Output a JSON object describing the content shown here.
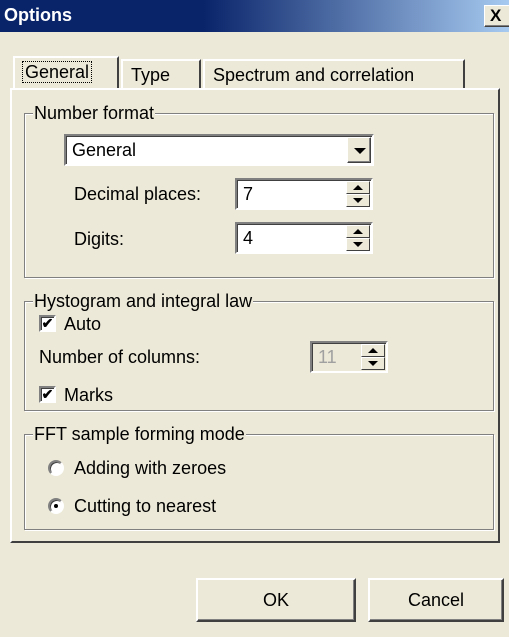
{
  "window": {
    "title": "Options",
    "close_glyph": "X"
  },
  "tabs": [
    {
      "label": "General",
      "active": true
    },
    {
      "label": "Type",
      "active": false
    },
    {
      "label": "Spectrum and correlation",
      "active": false
    }
  ],
  "number_format": {
    "legend": "Number format",
    "format_value": "General",
    "decimal_places_label": "Decimal places:",
    "decimal_places_value": "7",
    "digits_label": "Digits:",
    "digits_value": "4"
  },
  "histogram": {
    "legend": "Hystogram and integral law",
    "auto_label": "Auto",
    "auto_checked": true,
    "columns_label": "Number of columns:",
    "columns_value": "11",
    "marks_label": "Marks",
    "marks_checked": true
  },
  "fft": {
    "legend": "FFT sample forming mode",
    "options": [
      {
        "label": "Adding with zeroes",
        "selected": false
      },
      {
        "label": "Cutting to nearest",
        "selected": true
      }
    ]
  },
  "buttons": {
    "ok": "OK",
    "cancel": "Cancel"
  },
  "icons": {
    "check": "check-mark-icon",
    "dropdown": "chevron-down-icon",
    "close": "close-icon"
  }
}
